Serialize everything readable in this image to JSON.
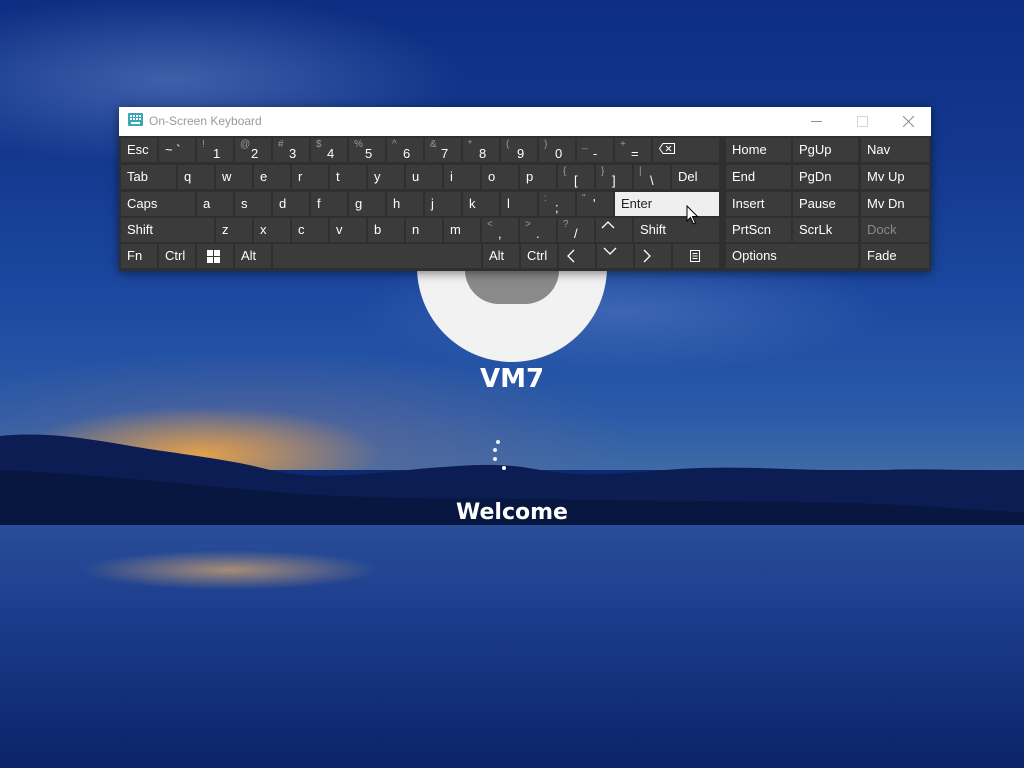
{
  "login": {
    "user_name": "VM7",
    "welcome_text": "Welcome"
  },
  "osk": {
    "title": "On-Screen Keyboard",
    "controls": {
      "minimize": "minimize-icon",
      "maximize": "maximize-icon",
      "close": "close-icon"
    },
    "rows": {
      "row1": {
        "esc": "Esc",
        "backtick": {
          "shift": "~",
          "main": "`"
        },
        "k1": {
          "shift": "!",
          "main": "1"
        },
        "k2": {
          "shift": "@",
          "main": "2"
        },
        "k3": {
          "shift": "#",
          "main": "3"
        },
        "k4": {
          "shift": "$",
          "main": "4"
        },
        "k5": {
          "shift": "%",
          "main": "5"
        },
        "k6": {
          "shift": "^",
          "main": "6"
        },
        "k7": {
          "shift": "&",
          "main": "7"
        },
        "k8": {
          "shift": "*",
          "main": "8"
        },
        "k9": {
          "shift": "(",
          "main": "9"
        },
        "k0": {
          "shift": ")",
          "main": "0"
        },
        "minus": {
          "shift": "_",
          "main": "-"
        },
        "equals": {
          "shift": "+",
          "main": "="
        },
        "backspace_icon": "backspace-icon"
      },
      "row2": {
        "tab": "Tab",
        "letters": [
          "q",
          "w",
          "e",
          "r",
          "t",
          "y",
          "u",
          "i",
          "o",
          "p"
        ],
        "lbracket": {
          "shift": "{",
          "main": "["
        },
        "rbracket": {
          "shift": "}",
          "main": "]"
        },
        "backslash": {
          "shift": "|",
          "main": "\\"
        },
        "del": "Del"
      },
      "row3": {
        "caps": "Caps",
        "letters": [
          "a",
          "s",
          "d",
          "f",
          "g",
          "h",
          "j",
          "k",
          "l"
        ],
        "semicolon": {
          "shift": ":",
          "main": ";"
        },
        "quote": {
          "shift": "\"",
          "main": "'"
        },
        "enter": "Enter"
      },
      "row4": {
        "shift_left": "Shift",
        "letters": [
          "z",
          "x",
          "c",
          "v",
          "b",
          "n",
          "m"
        ],
        "comma": {
          "shift": "<",
          "main": ","
        },
        "period": {
          "shift": ">",
          "main": "."
        },
        "slash": {
          "shift": "?",
          "main": "/"
        },
        "up_icon": "arrow-up-icon",
        "shift_right": "Shift"
      },
      "row5": {
        "fn": "Fn",
        "ctrl_left": "Ctrl",
        "win_icon": "windows-icon",
        "alt_left": "Alt",
        "alt_right": "Alt",
        "ctrl_right": "Ctrl",
        "left_icon": "arrow-left-icon",
        "down_icon": "arrow-down-icon",
        "right_icon": "arrow-right-icon",
        "menu_icon": "context-menu-icon"
      }
    },
    "nav_keys": {
      "home": "Home",
      "pgup": "PgUp",
      "end": "End",
      "pgdn": "PgDn",
      "insert": "Insert",
      "pause": "Pause",
      "prtscn": "PrtScn",
      "scrlk": "ScrLk",
      "options": "Options"
    },
    "side_keys": {
      "nav": "Nav",
      "mvup": "Mv Up",
      "mvdn": "Mv Dn",
      "dock": "Dock",
      "fade": "Fade"
    }
  },
  "colors": {
    "key_bg": "#3b3b3b",
    "keyboard_bg": "#2f2f2f",
    "enter_highlight": "#efefef",
    "titlebar_bg": "#ffffff"
  }
}
